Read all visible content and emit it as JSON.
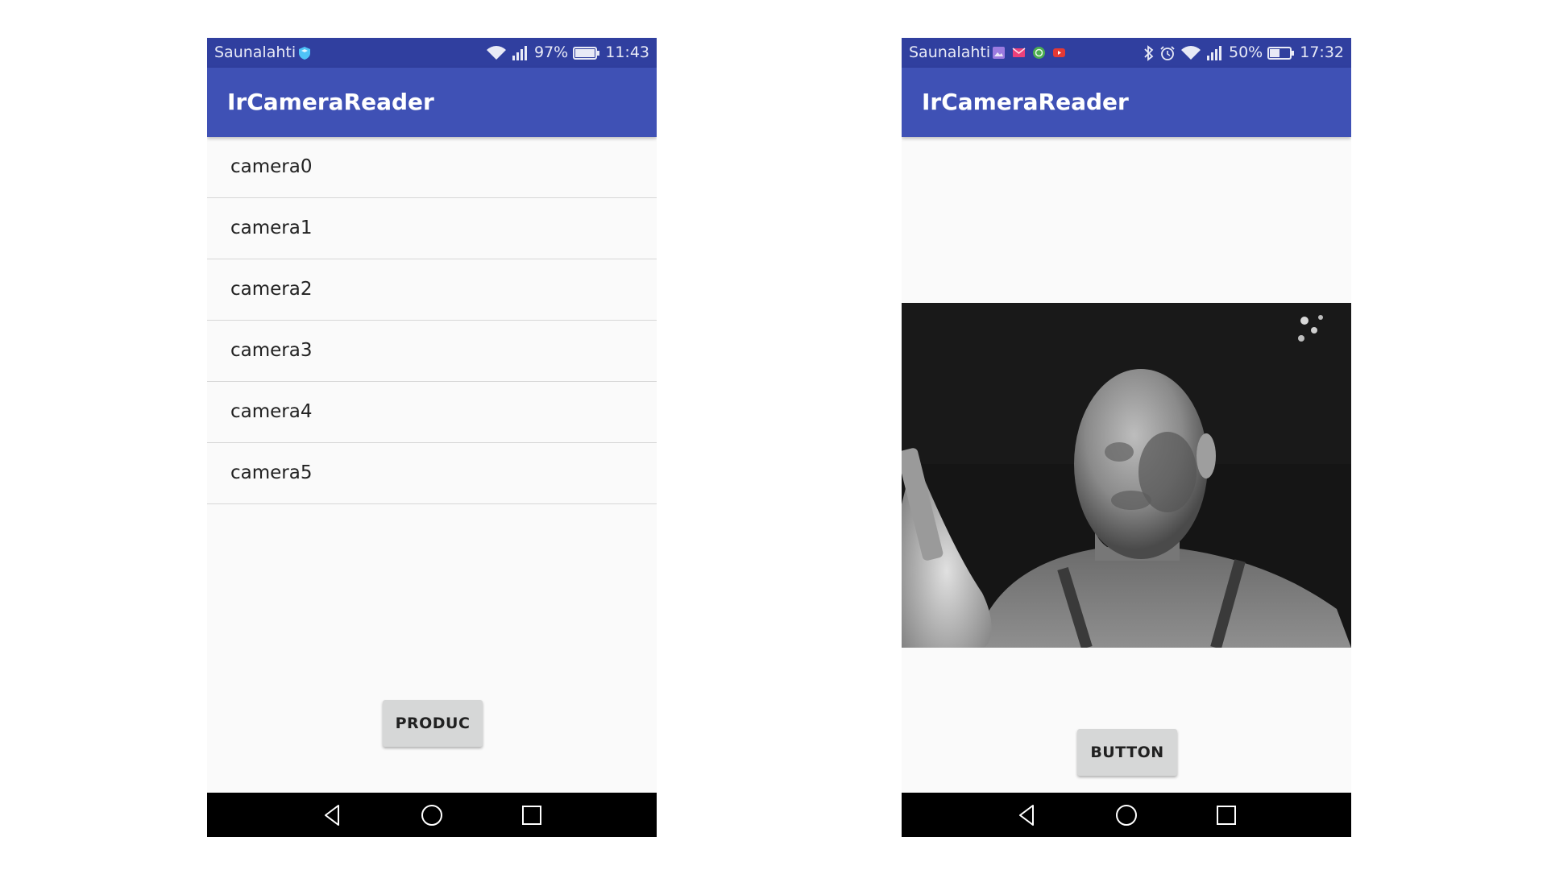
{
  "left_screen": {
    "status": {
      "carrier": "Saunalahti",
      "battery_percent": "97%",
      "time": "11:43"
    },
    "app_title": "IrCameraReader",
    "cameras": [
      "camera0",
      "camera1",
      "camera2",
      "camera3",
      "camera4",
      "camera5"
    ],
    "button_label": "PRODUC"
  },
  "right_screen": {
    "status": {
      "carrier": "Saunalahti",
      "battery_percent": "50%",
      "time": "17:32"
    },
    "app_title": "IrCameraReader",
    "button_label": "BUTTON"
  },
  "colors": {
    "status_bar": "#303f9f",
    "app_bar": "#3f51b5",
    "background": "#fafafa",
    "button": "#d6d7d7",
    "nav_bar": "#000000"
  },
  "icons": {
    "left_status": [
      "shield-icon",
      "wifi-icon",
      "signal-icon",
      "battery-icon"
    ],
    "right_status": [
      "gallery-icon",
      "mail-icon",
      "whatsapp-icon",
      "youtube-icon",
      "bluetooth-icon",
      "alarm-icon",
      "wifi-icon",
      "signal-icon",
      "battery-icon"
    ],
    "nav": [
      "back-icon",
      "home-icon",
      "recent-apps-icon"
    ]
  }
}
